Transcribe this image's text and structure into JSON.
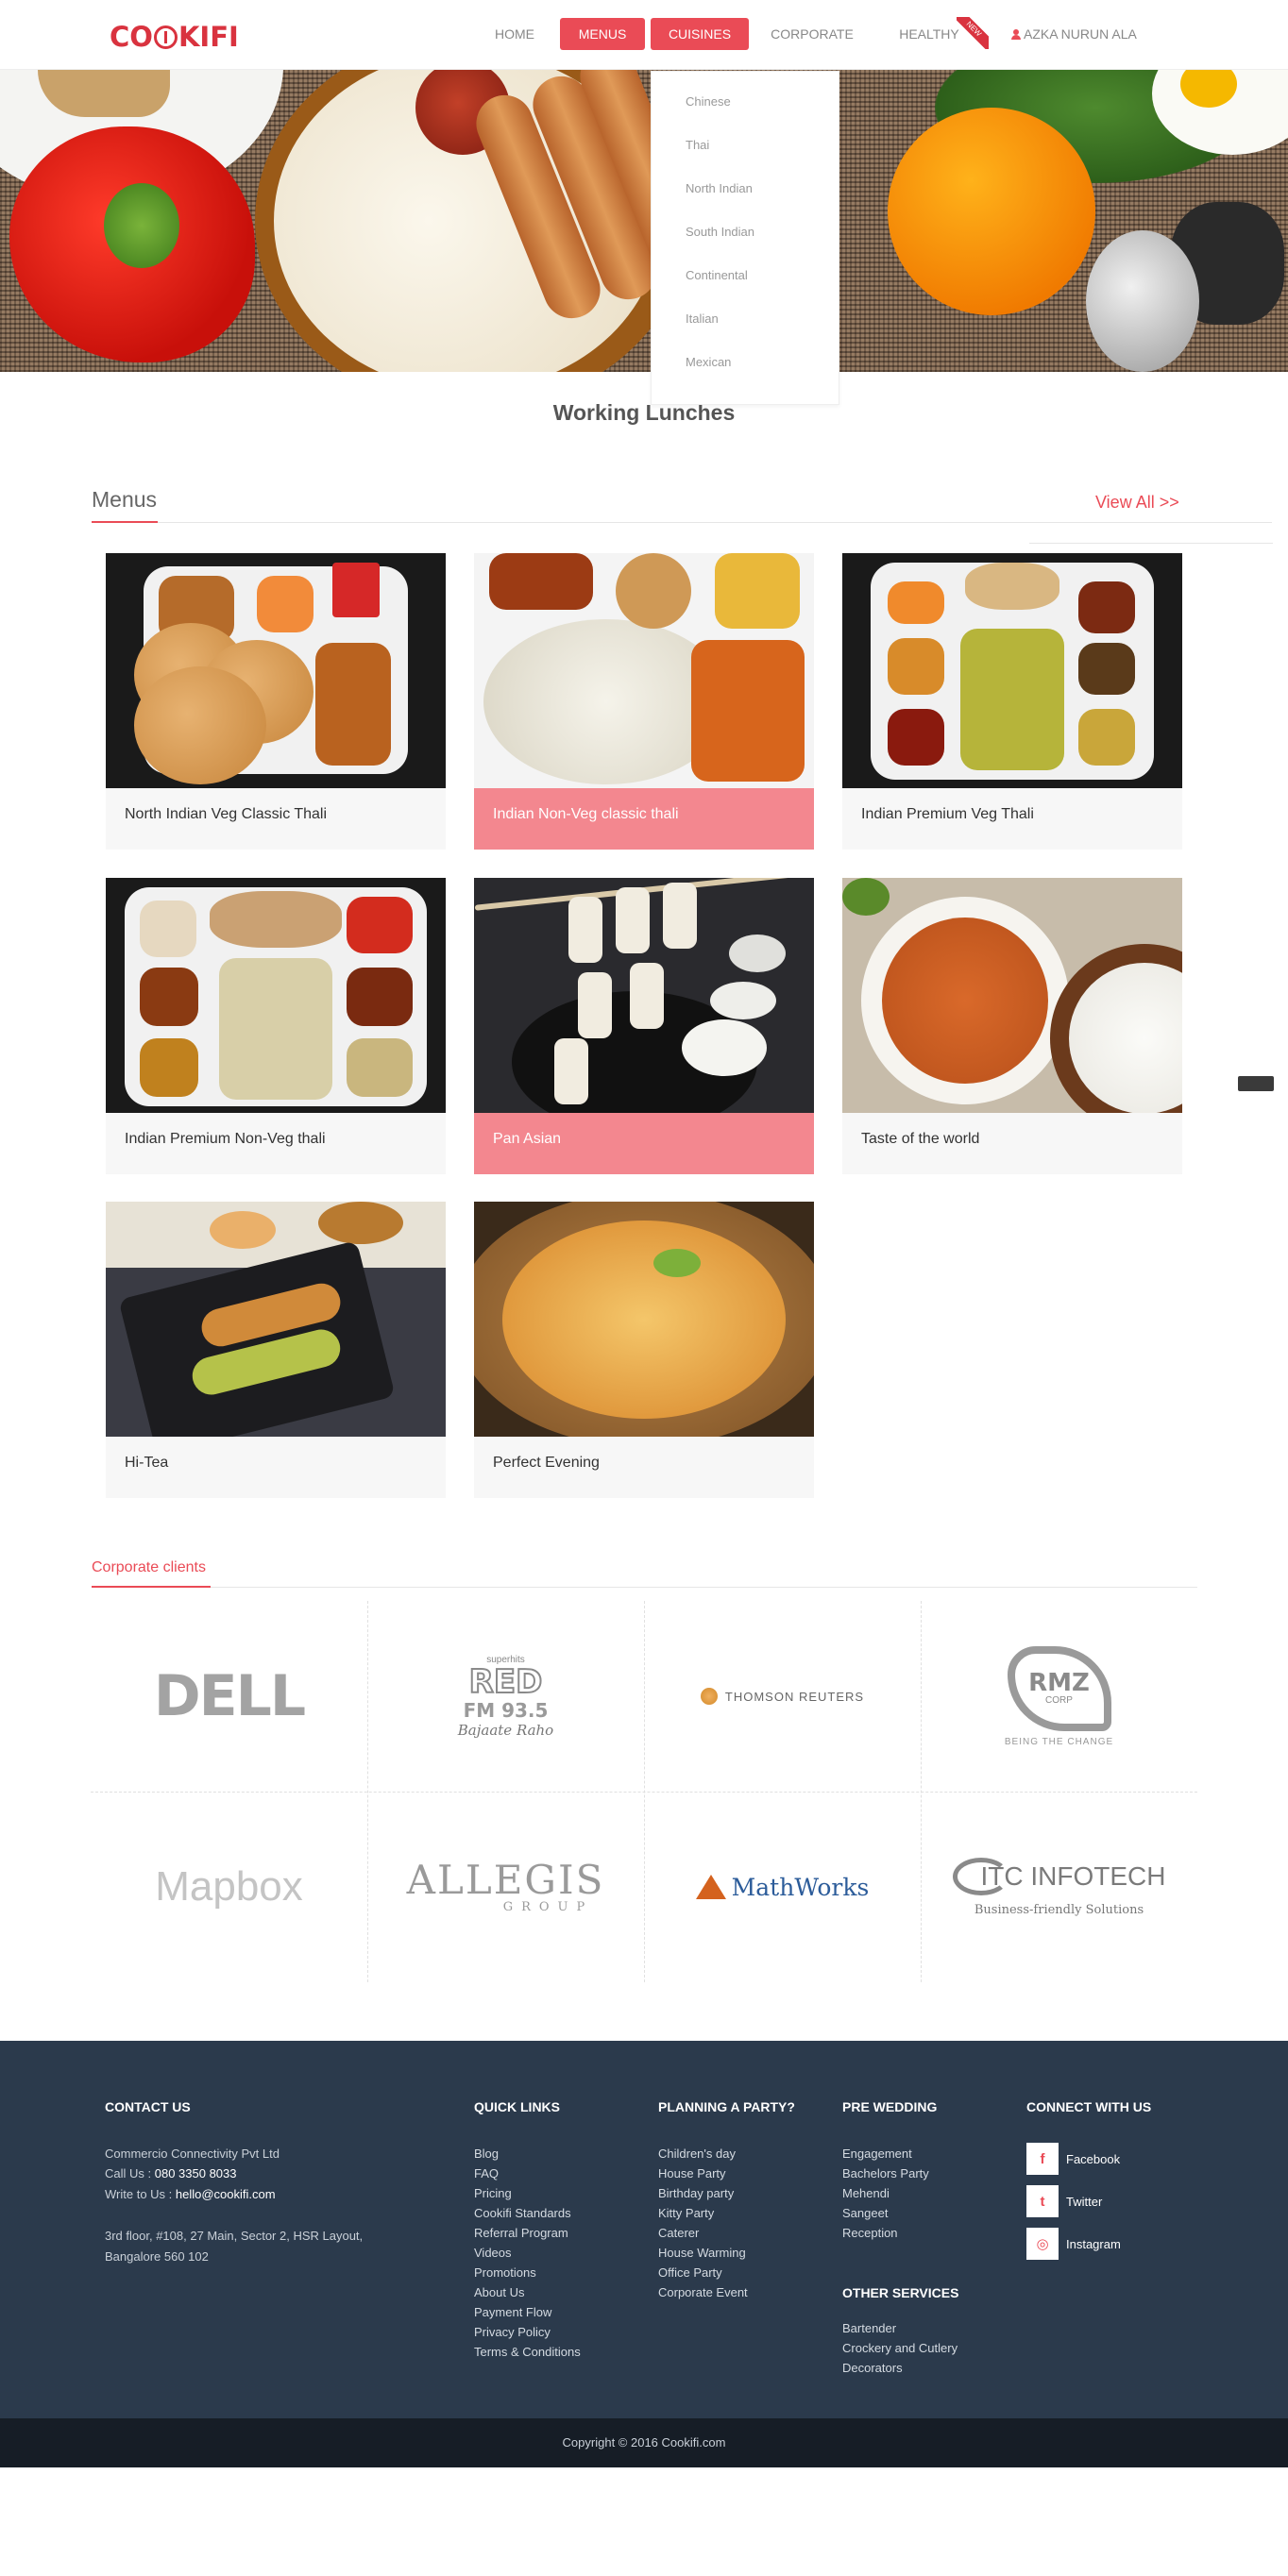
{
  "brand": {
    "logo_text_1": "CO",
    "logo_text_2": "KIFI",
    "accent": "#ea4b56",
    "logo_color": "#d9333f"
  },
  "nav": {
    "home": "HOME",
    "menus": "MENUS",
    "cuisines": "CUISINES",
    "corporate": "CORPORATE",
    "healthy": "HEALTHY",
    "healthy_badge": "NEW",
    "user": "AZKA NURUN ALA"
  },
  "cuisines_dropdown": [
    "Chinese",
    "Thai",
    "North Indian",
    "South Indian",
    "Continental",
    "Italian",
    "Mexican"
  ],
  "hero": {
    "caption": "Working Lunches"
  },
  "menus_section": {
    "title": "Menus",
    "view_all": "View All >>",
    "cards": [
      {
        "label": "North Indian Veg Classic Thali"
      },
      {
        "label": "Indian Non-Veg classic thali"
      },
      {
        "label": "Indian Premium Veg Thali"
      },
      {
        "label": "Indian Premium Non-Veg thali"
      },
      {
        "label": "Pan Asian"
      },
      {
        "label": "Taste of the world"
      },
      {
        "label": "Hi-Tea"
      },
      {
        "label": "Perfect Evening"
      }
    ]
  },
  "clients_section": {
    "title": "Corporate clients",
    "logos": {
      "dell": "DELL",
      "red_top": "superhits",
      "red_main": "RED",
      "red_fm": "FM 93.5",
      "red_tag": "Bajaate Raho",
      "thomson": "THOMSON REUTERS",
      "rmz": "RMZ",
      "rmz_corp": "CORP",
      "rmz_tag": "BEING THE CHANGE",
      "mapbox": "Mapbox",
      "allegis": "ALLEGIS",
      "allegis_sub": "GROUP",
      "mathworks": "MathWorks",
      "itc": "ITC INFOTECH",
      "itc_tag": "Business-friendly Solutions"
    }
  },
  "footer": {
    "contact": {
      "heading": "CONTACT US",
      "company": "Commercio Connectivity Pvt Ltd",
      "call_label": "Call Us : ",
      "phone": "080 3350 8033",
      "write_label": "Write to Us : ",
      "email": "hello@cookifi.com",
      "address_1": "3rd floor, #108, 27 Main, Sector 2, HSR Layout,",
      "address_2": "Bangalore 560 102"
    },
    "quick_links": {
      "heading": "QUICK LINKS",
      "items": [
        "Blog",
        "FAQ",
        "Pricing",
        "Cookifi Standards",
        "Referral Program",
        "Videos",
        "Promotions",
        "About Us",
        "Payment Flow",
        "Privacy Policy",
        "Terms & Conditions"
      ]
    },
    "party": {
      "heading": "PLANNING A PARTY?",
      "items": [
        "Children's day",
        "House Party",
        "Birthday party",
        "Kitty Party",
        "Caterer",
        "House Warming",
        "Office Party",
        "Corporate Event"
      ]
    },
    "wedding": {
      "heading": "PRE WEDDING",
      "items": [
        "Engagement",
        "Bachelors Party",
        "Mehendi",
        "Sangeet",
        "Reception"
      ]
    },
    "other": {
      "heading": "OTHER SERVICES",
      "items": [
        "Bartender",
        "Crockery and Cutlery",
        "Decorators"
      ]
    },
    "connect": {
      "heading": "CONNECT WITH US",
      "items": [
        {
          "label": "Facebook",
          "icon": "facebook-icon",
          "glyph": "f"
        },
        {
          "label": "Twitter",
          "icon": "twitter-icon",
          "glyph": "t"
        },
        {
          "label": "Instagram",
          "icon": "instagram-icon",
          "glyph": "◎"
        }
      ]
    },
    "copyright": "Copyright © 2016 Cookifi.com"
  }
}
